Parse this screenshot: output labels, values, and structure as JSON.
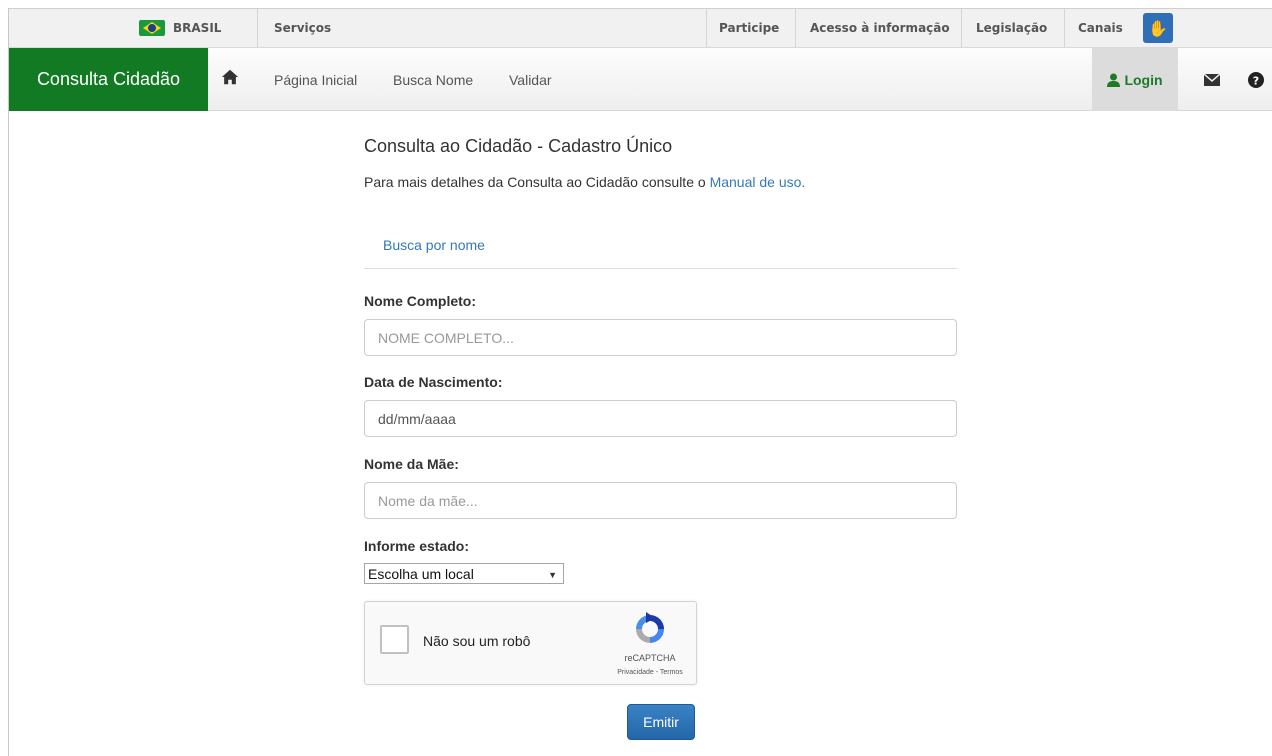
{
  "govbar": {
    "brasil": "BRASIL",
    "servicos": "Serviços",
    "participe": "Participe",
    "acesso": "Acesso à informação",
    "legislacao": "Legislação",
    "canais": "Canais"
  },
  "navbar": {
    "brand": "Consulta Cidadão",
    "links": [
      "Página Inicial",
      "Busca Nome",
      "Validar"
    ],
    "login": "Login"
  },
  "main": {
    "title": "Consulta ao Cidadão - Cadastro Único",
    "intro_text": "Para mais detalhes da Consulta ao Cidadão consulte o ",
    "intro_link": "Manual de uso.",
    "tab": "Busca por nome"
  },
  "form": {
    "nome_label": "Nome Completo:",
    "nome_placeholder": "NOME COMPLETO...",
    "data_label": "Data de Nascimento:",
    "data_value": "dd/mm/aaaa",
    "mae_label": "Nome da Mãe:",
    "mae_placeholder": "Nome da mãe...",
    "estado_label": "Informe estado:",
    "estado_selected": "Escolha um local"
  },
  "captcha": {
    "label": "Não sou um robô",
    "brand": "reCAPTCHA",
    "terms": "Privacidade - Termos"
  },
  "submit": "Emitir",
  "colors": {
    "brand_green": "#137a24",
    "link_blue": "#337ab7",
    "button_blue": "#2467a8"
  }
}
